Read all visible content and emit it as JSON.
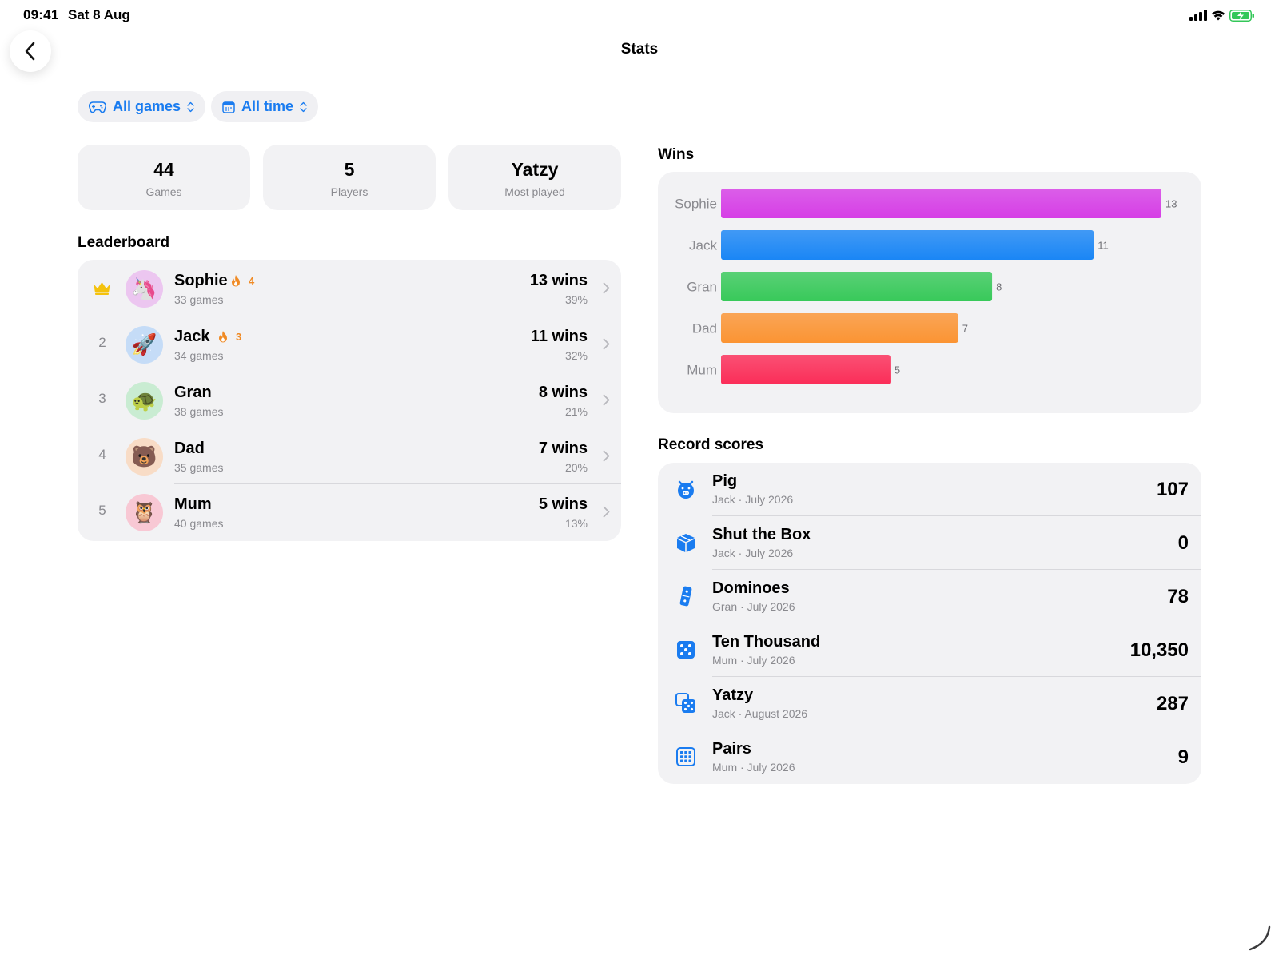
{
  "status_bar": {
    "time": "09:41",
    "date": "Sat 8 Aug"
  },
  "nav": {
    "title": "Stats",
    "back_icon": "chevron-left-icon"
  },
  "filters": [
    {
      "label": "All games",
      "icon": "gamecontroller-icon"
    },
    {
      "label": "All time",
      "icon": "calendar-icon"
    }
  ],
  "summary": [
    {
      "value": "44",
      "label": "Games"
    },
    {
      "value": "5",
      "label": "Players"
    },
    {
      "value": "Yatzy",
      "label": "Most played"
    }
  ],
  "leaderboard": {
    "title": "Leaderboard",
    "rows": [
      {
        "rank": "",
        "rank_icon": "crown-icon",
        "avatar": "🦄",
        "avatar_bg": "#ecc6f0",
        "name": "Sophie",
        "streak": "4",
        "games": "33 games",
        "wins": "13 wins",
        "pct": "39%"
      },
      {
        "rank": "2",
        "avatar": "🚀",
        "avatar_bg": "#c5dcf7",
        "name": "Jack",
        "streak": "3",
        "games": "34 games",
        "wins": "11 wins",
        "pct": "32%"
      },
      {
        "rank": "3",
        "avatar": "🐢",
        "avatar_bg": "#c9ecd2",
        "name": "Gran",
        "streak": "",
        "games": "38 games",
        "wins": "8 wins",
        "pct": "21%"
      },
      {
        "rank": "4",
        "avatar": "🐻",
        "avatar_bg": "#f8dcc6",
        "name": "Dad",
        "streak": "",
        "games": "35 games",
        "wins": "7 wins",
        "pct": "20%"
      },
      {
        "rank": "5",
        "avatar": "🦉",
        "avatar_bg": "#f8c8d4",
        "name": "Mum",
        "streak": "",
        "games": "40 games",
        "wins": "5 wins",
        "pct": "13%"
      }
    ]
  },
  "wins_chart": {
    "title": "Wins"
  },
  "chart_data": {
    "type": "bar",
    "orientation": "horizontal",
    "categories": [
      "Sophie",
      "Jack",
      "Gran",
      "Dad",
      "Mum"
    ],
    "values": [
      13,
      11,
      8,
      7,
      5
    ],
    "colors": [
      "#d63ee6",
      "#1a86f5",
      "#38c95a",
      "#fb9433",
      "#fb2d58"
    ],
    "xlim": [
      0,
      13
    ],
    "grid": false
  },
  "record_scores": {
    "title": "Record scores",
    "rows": [
      {
        "icon": "pig-icon",
        "game": "Pig",
        "sub": "Jack · July 2026",
        "score": "107"
      },
      {
        "icon": "box-icon",
        "game": "Shut the Box",
        "sub": "Jack · July 2026",
        "score": "0"
      },
      {
        "icon": "domino-icon",
        "game": "Dominoes",
        "sub": "Gran · July 2026",
        "score": "78"
      },
      {
        "icon": "die-five-icon",
        "game": "Ten Thousand",
        "sub": "Mum · July 2026",
        "score": "10,350"
      },
      {
        "icon": "dice-icon",
        "game": "Yatzy",
        "sub": "Jack · August 2026",
        "score": "287"
      },
      {
        "icon": "grid-icon",
        "game": "Pairs",
        "sub": "Mum · July 2026",
        "score": "9"
      }
    ]
  },
  "colors": {
    "accent": "#1a7cf0",
    "streak": "#f08a24",
    "crown": "#f4c20d"
  }
}
